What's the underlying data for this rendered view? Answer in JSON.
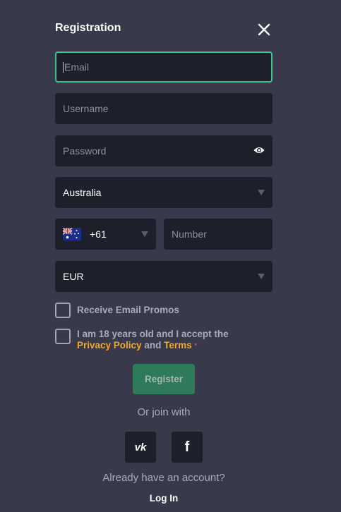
{
  "header": {
    "title": "Registration"
  },
  "form": {
    "email_placeholder": "Email",
    "username_placeholder": "Username",
    "password_placeholder": "Password",
    "country_value": "Australia",
    "phone_code": "+61",
    "number_placeholder": "Number",
    "currency_value": "EUR"
  },
  "checkboxes": {
    "promos_label": "Receive Email Promos",
    "terms_line1": "I am 18 years old and I accept the",
    "privacy_link": "Privacy Policy",
    "and_text": "and",
    "terms_link": "Terms",
    "required_mark": "*"
  },
  "actions": {
    "register_label": "Register",
    "join_text": "Or join with",
    "vk_label": "vk",
    "fb_label": "f",
    "account_text": "Already have an account?",
    "login_label": "Log In"
  },
  "colors": {
    "background": "#383a4b",
    "field_bg": "#1d1f2b",
    "focus_border": "#3ec387",
    "register_bg": "#2f7a5a",
    "link_accent": "#f6a623"
  },
  "icons": [
    "close-icon",
    "eye-icon",
    "chevron-down-icon",
    "australia-flag-icon",
    "vk-icon",
    "facebook-icon"
  ]
}
